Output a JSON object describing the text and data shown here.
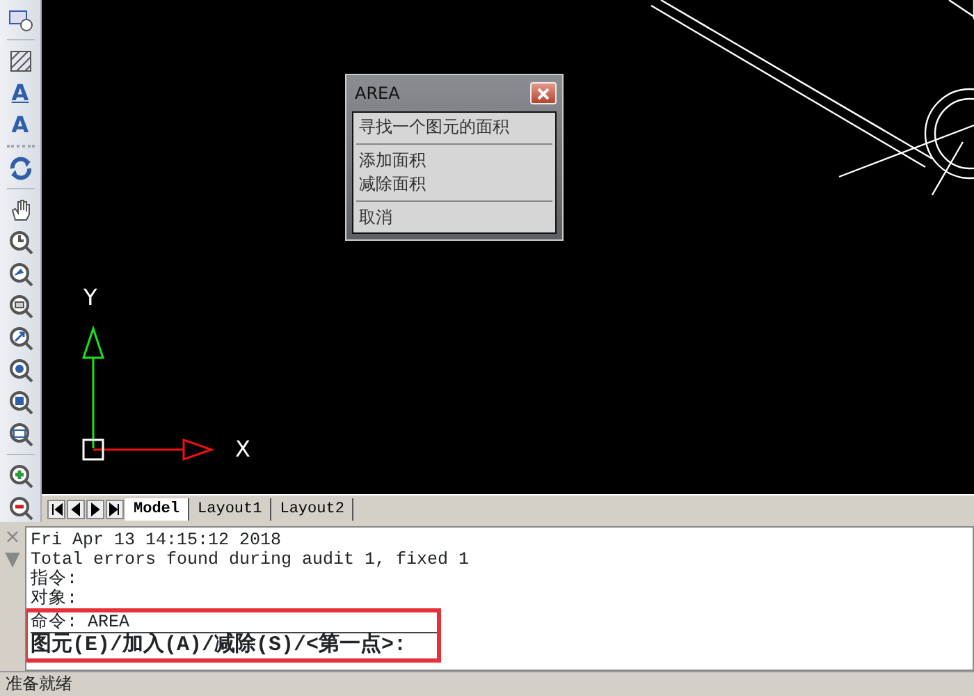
{
  "toolbar": [
    {
      "kind": "rect-circle"
    },
    {
      "kind": "separator"
    },
    {
      "kind": "hatch"
    },
    {
      "kind": "text-underlined",
      "glyph": "A"
    },
    {
      "kind": "text",
      "glyph": "A"
    },
    {
      "kind": "grip"
    },
    {
      "kind": "regen"
    },
    {
      "kind": "separator"
    },
    {
      "kind": "pan"
    },
    {
      "kind": "zoom-clock"
    },
    {
      "kind": "zoom-back"
    },
    {
      "kind": "zoom-page"
    },
    {
      "kind": "zoom-arrow"
    },
    {
      "kind": "zoom-plus-dot"
    },
    {
      "kind": "zoom-square"
    },
    {
      "kind": "zoom-window"
    },
    {
      "kind": "separator"
    },
    {
      "kind": "zoom-in"
    },
    {
      "kind": "zoom-out"
    }
  ],
  "canvas": {
    "ucs": {
      "y_label": "Y",
      "x_label": "X"
    }
  },
  "dialog": {
    "title": "AREA",
    "groups": [
      [
        "寻找一个图元的面积"
      ],
      [
        "添加面积",
        "减除面积"
      ],
      [
        "取消"
      ]
    ]
  },
  "layout_tabs": [
    {
      "label": "Model",
      "selected": true
    },
    {
      "label": "Layout1",
      "selected": false
    },
    {
      "label": "Layout2",
      "selected": false
    }
  ],
  "command": {
    "close": "×",
    "collapse": "▼",
    "history": [
      {
        "text": "Fri Apr 13 14:15:12 2018",
        "highlighted": false
      },
      {
        "text": "Total errors found during audit 1, fixed 1",
        "highlighted": false
      },
      {
        "text": "指令:",
        "highlighted": false
      },
      {
        "text": "对象:",
        "highlighted": false
      },
      {
        "text": "命令: AREA",
        "highlighted": true
      }
    ],
    "prompt": "图元(E)/加入(A)/减除(S)/<第一点>:"
  },
  "status_bar": "准备就绪"
}
